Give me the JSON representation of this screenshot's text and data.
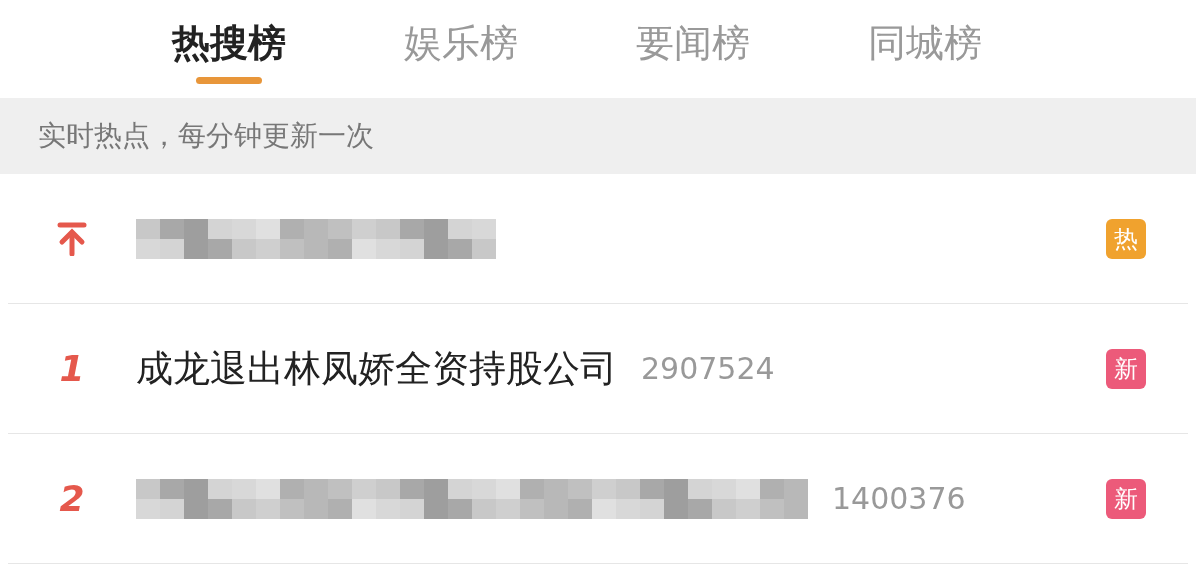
{
  "tabs": [
    {
      "label": "热搜榜",
      "selected": true
    },
    {
      "label": "娱乐榜",
      "selected": false
    },
    {
      "label": "要闻榜",
      "selected": false
    },
    {
      "label": "同城榜",
      "selected": false
    }
  ],
  "notice": "实时热点，每分钟更新一次",
  "rows": [
    {
      "kind": "pinned",
      "badge": "热",
      "color": "#f0a22e"
    },
    {
      "kind": "ranked",
      "rank": "1",
      "title": "成龙退出林凤娇全资持股公司",
      "count": "2907524",
      "badge": "新",
      "color": "#ec5a7a"
    },
    {
      "kind": "ranked",
      "rank": "2",
      "count": "1400376",
      "badge": "新",
      "color": "#ec5a7a"
    }
  ]
}
